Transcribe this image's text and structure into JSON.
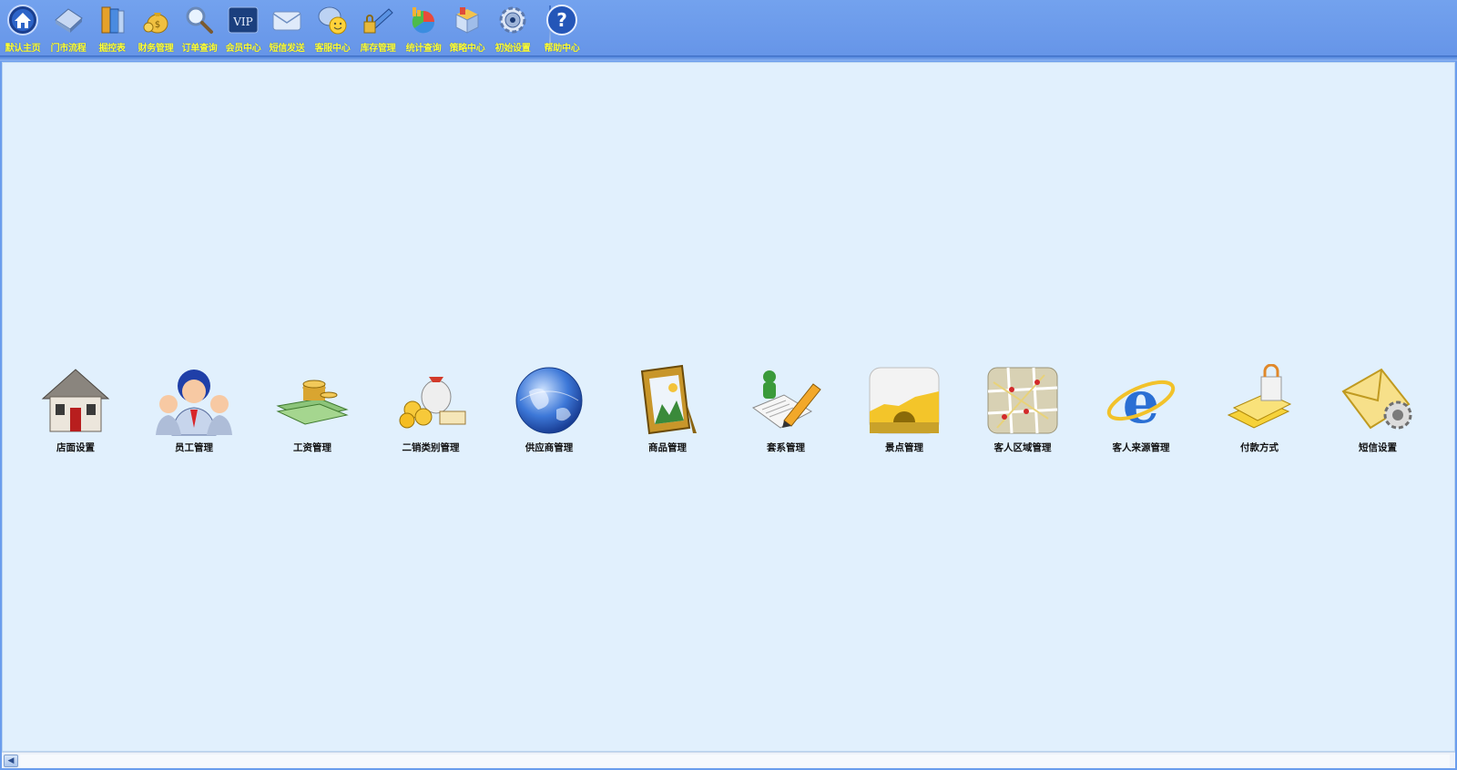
{
  "toolbar": {
    "items": [
      {
        "label": "默认主页",
        "icon": "home-icon"
      },
      {
        "label": "门市流程",
        "icon": "house-icon"
      },
      {
        "label": "掘控表",
        "icon": "books-icon"
      },
      {
        "label": "财务管理",
        "icon": "money-bag-icon"
      },
      {
        "label": "订单查询",
        "icon": "magnifier-icon"
      },
      {
        "label": "会员中心",
        "icon": "vip-card-icon"
      },
      {
        "label": "短信发送",
        "icon": "envelope-icon"
      },
      {
        "label": "客服中心",
        "icon": "smiley-chat-icon"
      },
      {
        "label": "库存管理",
        "icon": "lock-book-icon"
      },
      {
        "label": "统计查询",
        "icon": "pie-chart-icon"
      },
      {
        "label": "策略中心",
        "icon": "box-icon"
      },
      {
        "label": "初始设置",
        "icon": "gear-icon"
      },
      {
        "label": "帮助中心",
        "icon": "help-icon"
      }
    ]
  },
  "tiles": [
    {
      "label": "店面设置",
      "icon": "house-icon"
    },
    {
      "label": "员工管理",
      "icon": "staff-icon"
    },
    {
      "label": "工资管理",
      "icon": "cash-coins-icon"
    },
    {
      "label": "二销类别管理",
      "icon": "money-bag-coins-icon"
    },
    {
      "label": "供应商管理",
      "icon": "globe-icon"
    },
    {
      "label": "商品管理",
      "icon": "picture-frame-icon"
    },
    {
      "label": "套系管理",
      "icon": "document-pencil-icon"
    },
    {
      "label": "景点管理",
      "icon": "great-wall-icon"
    },
    {
      "label": "客人区域管理",
      "icon": "map-icon"
    },
    {
      "label": "客人来源管理",
      "icon": "internet-explorer-icon"
    },
    {
      "label": "付款方式",
      "icon": "card-lock-icon"
    },
    {
      "label": "短信设置",
      "icon": "envelope-gear-icon"
    }
  ],
  "colors": {
    "toolbar_bg": "#6b9ded",
    "toolbar_label": "#ffff33",
    "main_bg": "#e1f0fd",
    "tile_label": "#111111"
  }
}
